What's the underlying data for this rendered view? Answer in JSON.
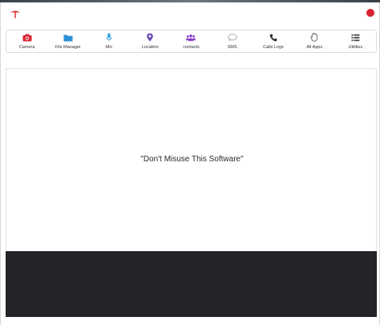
{
  "toolbar": {
    "items": [
      {
        "label": "Camera",
        "icon": "camera-icon",
        "color": "#d9232f"
      },
      {
        "label": "File Manager",
        "icon": "folder-icon",
        "color": "#2b8fd3"
      },
      {
        "label": "Mic",
        "icon": "microphone-icon",
        "color": "#2b9fe0"
      },
      {
        "label": "Location",
        "icon": "location-pin-icon",
        "color": "#6a4ab8"
      },
      {
        "label": "contacts",
        "icon": "users-icon",
        "color": "#8a3fc9"
      },
      {
        "label": "SMS",
        "icon": "chat-bubble-icon",
        "color": "#a6a6a6"
      },
      {
        "label": "Calls Logs",
        "icon": "phone-icon",
        "color": "#2a2a2a"
      },
      {
        "label": "All Apps",
        "icon": "hand-icon",
        "color": "#555555"
      },
      {
        "label": "Utilities",
        "icon": "list-icon",
        "color": "#444444"
      }
    ]
  },
  "main": {
    "message": "\"Don't Misuse This Software\""
  },
  "colors": {
    "accent": "#d9232f",
    "console_bg": "#232427"
  }
}
